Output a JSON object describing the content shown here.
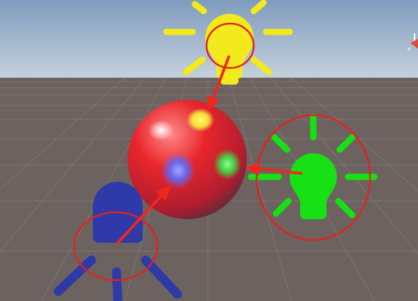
{
  "scene": {
    "sky_top": "#7f9bbd",
    "sky_horizon": "#c9d4de",
    "ground": "#6c6360",
    "grid_line": "#857c78",
    "sphere_base": "#e8262c",
    "sphere_shadow": "#2f3440"
  },
  "lights": [
    {
      "name": "yellow-point-light",
      "color": "#f2ea1c",
      "icon": "lightbulb-icon"
    },
    {
      "name": "green-point-light",
      "color": "#17e014",
      "icon": "lightbulb-icon"
    },
    {
      "name": "blue-spot-light",
      "color": "#2e3aa8",
      "icon": "spotlight-icon"
    }
  ],
  "specular_highlights": [
    {
      "name": "white",
      "color": "#ffffff"
    },
    {
      "name": "yellow",
      "color": "#f7ef3a"
    },
    {
      "name": "green",
      "color": "#39e24a"
    },
    {
      "name": "blue",
      "color": "#5d6bff"
    }
  ],
  "annotations": {
    "circle_color": "#e0231c",
    "arrow_color": "#f0281c"
  },
  "gizmo": {
    "x_color": "#e04a3a",
    "y_color": "#ffffff"
  }
}
